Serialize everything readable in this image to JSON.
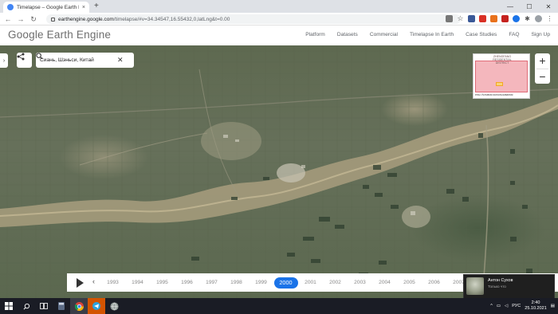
{
  "browser": {
    "tab_title": "Timelapse – Google Earth Engine",
    "tab_close": "×",
    "new_tab": "+",
    "url_host": "earthengine.google.com",
    "url_path": "/timelapse/#v=34.34547,16.55432,0,latLng&t=0.00",
    "window_controls": [
      "—",
      "☐",
      "✕"
    ]
  },
  "header": {
    "logo": "Google Earth Engine",
    "nav": [
      "Platform",
      "Datasets",
      "Commercial",
      "Timelapse In Earth",
      "Case Studies",
      "FAQ",
      "Sign Up"
    ]
  },
  "search": {
    "value": "Сиань, Шэньси, Китай",
    "clear": "✕"
  },
  "minimap": {
    "label": "ZHENGFANG RESIDENTIAL DISTRICT",
    "footer": "ены Условия использования"
  },
  "zoom": {
    "in": "+",
    "out": "−"
  },
  "timeline": {
    "prev": "‹",
    "years": [
      "1993",
      "1994",
      "1995",
      "1996",
      "1997",
      "1998",
      "1999",
      "2000",
      "2001",
      "2002",
      "2003",
      "2004",
      "2005",
      "2006",
      "2007"
    ],
    "active_year": "2000"
  },
  "notification": {
    "name": "Антон Сухов",
    "sub": "Только что"
  },
  "taskbar": {
    "lang": "РУС",
    "time": "2:40",
    "date": "25.10.2021"
  },
  "colors": {
    "accent": "#1a73e8",
    "map_base": "#5e6950",
    "river": "#a89d7e"
  }
}
